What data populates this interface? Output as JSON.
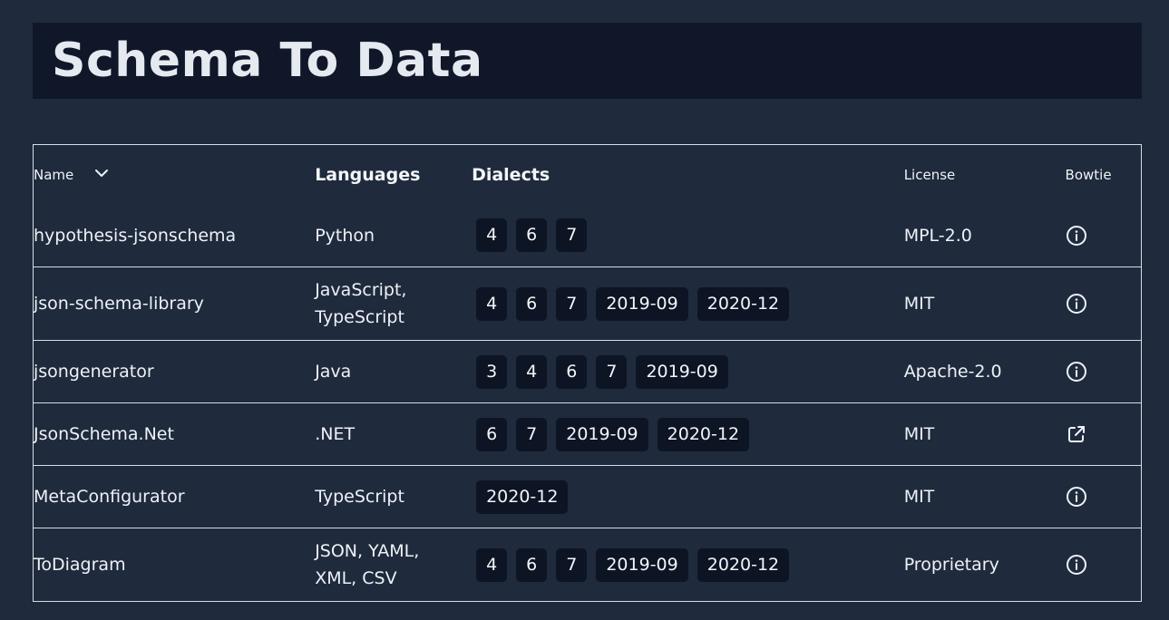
{
  "page": {
    "title": "Schema To Data"
  },
  "table": {
    "headers": {
      "name": "Name",
      "languages": "Languages",
      "dialects": "Dialects",
      "license": "License",
      "bowtie": "Bowtie"
    },
    "rows": [
      {
        "name": "hypothesis-jsonschema",
        "languages": [
          "Python"
        ],
        "dialects": [
          "4",
          "6",
          "7"
        ],
        "license": "MPL-2.0",
        "bowtie_icon": "info-icon"
      },
      {
        "name": "json-schema-library",
        "languages": [
          "JavaScript,",
          "TypeScript"
        ],
        "dialects": [
          "4",
          "6",
          "7",
          "2019-09",
          "2020-12"
        ],
        "license": "MIT",
        "bowtie_icon": "info-icon"
      },
      {
        "name": "jsongenerator",
        "languages": [
          "Java"
        ],
        "dialects": [
          "3",
          "4",
          "6",
          "7",
          "2019-09"
        ],
        "license": "Apache-2.0",
        "bowtie_icon": "info-icon"
      },
      {
        "name": "JsonSchema.Net",
        "languages": [
          ".NET"
        ],
        "dialects": [
          "6",
          "7",
          "2019-09",
          "2020-12"
        ],
        "license": "MIT",
        "bowtie_icon": "external-link-icon"
      },
      {
        "name": "MetaConfigurator",
        "languages": [
          "TypeScript"
        ],
        "dialects": [
          "2020-12"
        ],
        "license": "MIT",
        "bowtie_icon": "info-icon"
      },
      {
        "name": "ToDiagram",
        "languages": [
          "JSON, YAML,",
          "XML, CSV"
        ],
        "dialects": [
          "4",
          "6",
          "7",
          "2019-09",
          "2020-12"
        ],
        "license": "Proprietary",
        "bowtie_icon": "info-icon"
      }
    ]
  },
  "colors": {
    "background": "#1f2a3c",
    "title_bar": "#0f1729",
    "badge": "#0d1424",
    "border": "#d7dde7"
  }
}
